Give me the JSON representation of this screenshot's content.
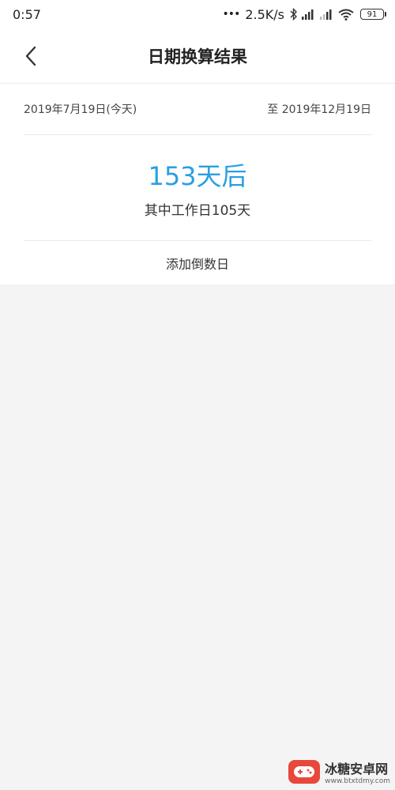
{
  "status_bar": {
    "time": "0:57",
    "dots": "•••",
    "network_speed": "2.5K/s",
    "battery": "91",
    "icons": [
      "bluetooth-icon",
      "signal-icon",
      "signal-icon",
      "wifi-icon",
      "battery-icon"
    ]
  },
  "header": {
    "title": "日期换算结果",
    "back_icon": "chevron-left-icon"
  },
  "result": {
    "start_date": "2019年7月19日(今天)",
    "end_date": "至 2019年12月19日",
    "days": "153天后",
    "workdays": "其中工作日105天",
    "add_countdown": "添加倒数日"
  },
  "watermark": {
    "name": "冰糖安卓网",
    "url": "www.btxtdmy.com"
  },
  "colors": {
    "accent": "#2a9fe0",
    "background": "#f4f4f5",
    "card": "#ffffff",
    "watermark_red": "#e8473b"
  }
}
